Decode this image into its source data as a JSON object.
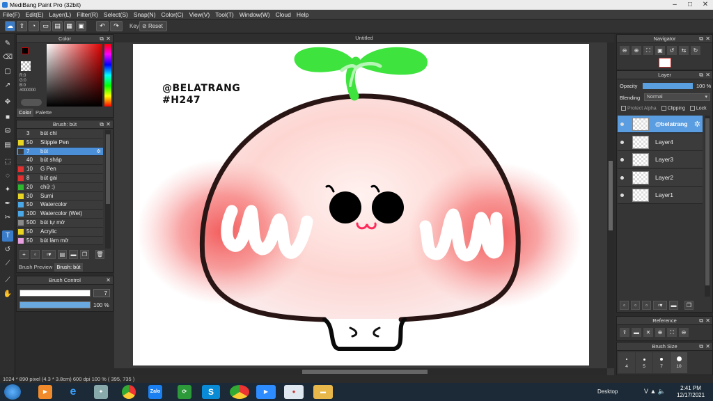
{
  "window": {
    "title": "MediBang Paint Pro (32bit)"
  },
  "menu": [
    "File(F)",
    "Edit(E)",
    "Layer(L)",
    "Filter(R)",
    "Select(S)",
    "Snap(N)",
    "Color(C)",
    "View(V)",
    "Tool(T)",
    "Window(W)",
    "Cloud",
    "Help"
  ],
  "toolbar": {
    "key_label": "Key",
    "reset_label": "Reset"
  },
  "color_panel": {
    "title": "Color",
    "readout": [
      "R:0",
      "G:0",
      "B:0",
      "#000000"
    ],
    "tabs": [
      "Color",
      "Palette"
    ],
    "foreground": "#000000",
    "background": "#ffffff"
  },
  "brush_panel": {
    "title": "Brush: bút",
    "items": [
      {
        "size": "3",
        "name": "bút chì",
        "color": "#3a3a3a"
      },
      {
        "size": "50",
        "name": "Stipple Pen",
        "color": "#e8d422"
      },
      {
        "size": "7",
        "name": "bút",
        "color": "#3a3a3a"
      },
      {
        "size": "40",
        "name": "bút sháp",
        "color": "#3a3a3a"
      },
      {
        "size": "10",
        "name": "G Pen",
        "color": "#e03030"
      },
      {
        "size": "8",
        "name": "bút gai",
        "color": "#e03030"
      },
      {
        "size": "20",
        "name": "chữ :)",
        "color": "#2fb82f"
      },
      {
        "size": "30",
        "name": "Sumi",
        "color": "#e8d422"
      },
      {
        "size": "50",
        "name": "Watercolor",
        "color": "#4aa8e8"
      },
      {
        "size": "100",
        "name": "Watercolor (Wet)",
        "color": "#4aa8e8"
      },
      {
        "size": "500",
        "name": "bút tự mờ",
        "color": "#8a8a8a"
      },
      {
        "size": "50",
        "name": "Acrylic",
        "color": "#e8d422"
      },
      {
        "size": "50",
        "name": "bút làm mờ",
        "color": "#e8a0e0"
      }
    ],
    "tabs": [
      "Brush Preview",
      "Brush: bút"
    ]
  },
  "brush_control": {
    "title": "Brush Control",
    "size_value": "7",
    "opacity_value": "100 %"
  },
  "canvas": {
    "tab_title": "Untitled",
    "watermark_line1": "@BELATRANG",
    "watermark_line2": "#H247"
  },
  "navigator": {
    "title": "Navigator"
  },
  "layer_panel": {
    "title": "Layer",
    "opacity_label": "Opacity",
    "opacity_value": "100 %",
    "blending_label": "Blending",
    "blending_value": "Normal",
    "protect_alpha": "Protect Alpha",
    "clipping": "Clipping",
    "lock": "Lock",
    "layers": [
      {
        "name": "@belatrang",
        "selected": true
      },
      {
        "name": "Layer4",
        "selected": false
      },
      {
        "name": "Layer3",
        "selected": false
      },
      {
        "name": "Layer2",
        "selected": false
      },
      {
        "name": "Layer1",
        "selected": false
      }
    ]
  },
  "reference_panel": {
    "title": "Reference"
  },
  "brush_size_panel": {
    "title": "Brush Size",
    "sizes": [
      "4",
      "5",
      "7",
      "10"
    ]
  },
  "status": {
    "text": "1024 * 890 pixel  (4.3 * 3.8cm)  600 dpi  100 %  ( 395, 735 )"
  },
  "taskbar": {
    "desktop_label": "Desktop",
    "time": "2:41 PM",
    "date": "12/17/2021",
    "apps": [
      "start",
      "media",
      "ie",
      "tool",
      "chrome",
      "zalo",
      "sync",
      "skype",
      "chrome2",
      "zoom",
      "medibang",
      "explorer"
    ]
  }
}
